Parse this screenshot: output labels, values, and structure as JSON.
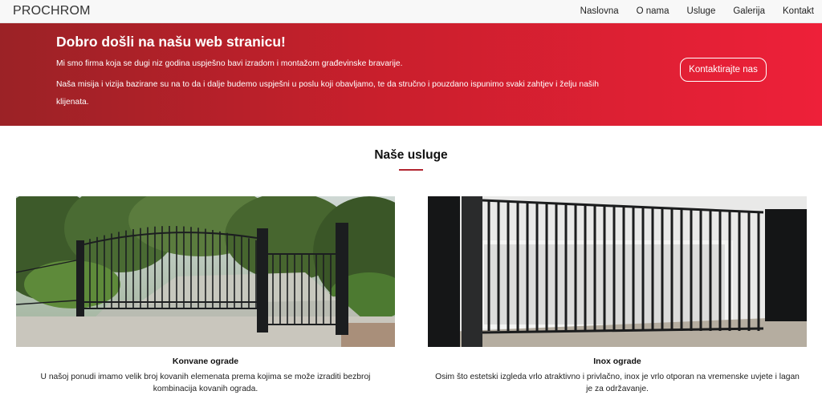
{
  "navbar": {
    "brand": "PROCHROM",
    "links": [
      "Naslovna",
      "O nama",
      "Usluge",
      "Galerija",
      "Kontakt"
    ]
  },
  "hero": {
    "title": "Dobro došli na našu web stranicu!",
    "line1": "Mi smo firma koja se dugi niz godina uspješno bavi izradom i montažom građevinske bravarije.",
    "line2": "Naša misija i vizija bazirane su na to da i dalje budemo uspješni u poslu koji obavljamo, te da stručno i pouzdano ispunimo svaki zahtjev i želju naših klijenata.",
    "button": "Kontaktirajte nas"
  },
  "services": {
    "title": "Naše usluge",
    "cards": [
      {
        "title": "Konvane ograde",
        "text": "U našoj ponudi imamo velik broj kovanih elemenata prema kojima se može izraditi bezbroj kombinacija kovanih ograda."
      },
      {
        "title": "Inox ograde",
        "text": "Osim što estetski izgleda vrlo atraktivno i privlačno, inox je vrlo otporan na vremenske uvjete i lagan je za održavanje."
      }
    ]
  },
  "colors": {
    "hero_start": "#9b2226",
    "hero_end": "#ee2039",
    "accent": "#b22531"
  }
}
